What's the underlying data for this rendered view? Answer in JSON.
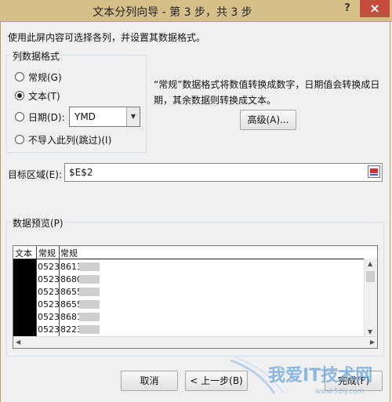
{
  "window": {
    "title": "文本分列向导 - 第 3 步，共 3 步",
    "help": "?",
    "close": "×"
  },
  "instruction": "使用此屏内容可选择各列，并设置其数据格式。",
  "column_format": {
    "group_label": "列数据格式",
    "options": [
      {
        "label": "常规(G)",
        "checked": false
      },
      {
        "label": "文本(T)",
        "checked": true
      },
      {
        "label": "日期(D):",
        "checked": false
      },
      {
        "label": "不导入此列(跳过)(I)",
        "checked": false
      }
    ],
    "date_format_selected": "YMD"
  },
  "description": "“常规”数据格式将数值转换成数字，日期值会转换成日期，其余数据则转换成文本。",
  "advanced_button": "高级(A)...",
  "destination": {
    "label": "目标区域(E):",
    "value": "$E$2"
  },
  "preview": {
    "label": "数据预览(P)",
    "headers": [
      "文本",
      "常规",
      "常规"
    ],
    "rows": [
      [
        "",
        "0523",
        "8613"
      ],
      [
        "",
        "0523",
        "8680"
      ],
      [
        "",
        "0523",
        "8655"
      ],
      [
        "",
        "0523",
        "8655"
      ],
      [
        "",
        "0523",
        "8681"
      ],
      [
        "",
        "0523",
        "8223"
      ]
    ]
  },
  "buttons": {
    "cancel": "取消",
    "back": "< 上一步(B)",
    "finish": "完成(F)"
  },
  "watermark": {
    "text": "我爱IT技术网",
    "url": "www.52ij.com"
  }
}
